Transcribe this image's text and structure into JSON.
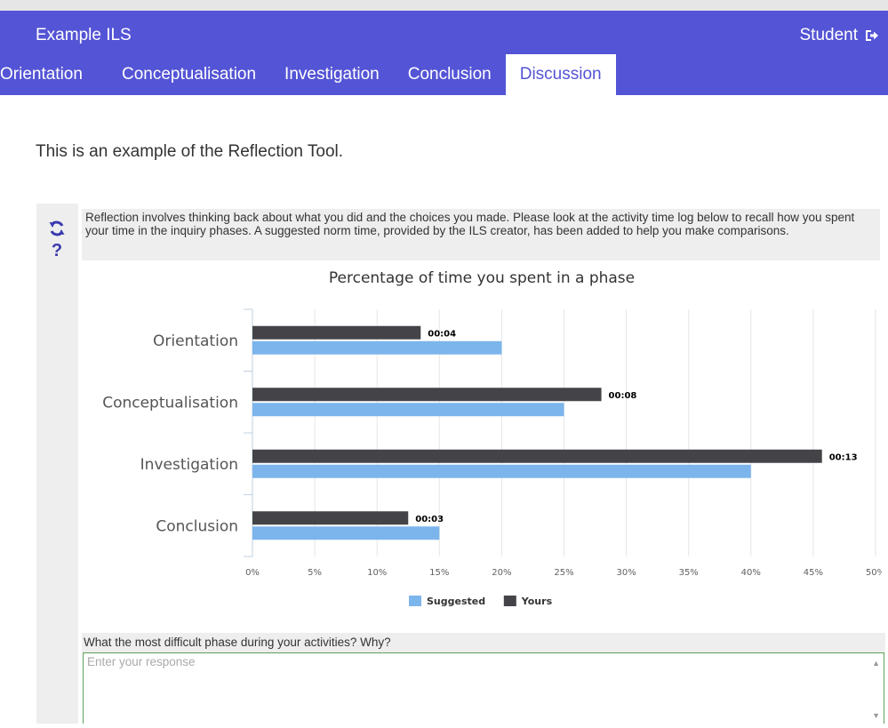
{
  "header": {
    "app_title": "Example ILS",
    "user_label": "Student",
    "user_icon": "sign-out-icon",
    "background": "#5454d6"
  },
  "tabs": [
    {
      "label": "Orientation",
      "active": false
    },
    {
      "label": "Conceptualisation",
      "active": false
    },
    {
      "label": "Investigation",
      "active": false
    },
    {
      "label": "Conclusion",
      "active": false
    },
    {
      "label": "Discussion",
      "active": true
    }
  ],
  "intro_text": "This is an example of the Reflection Tool.",
  "side_icons": [
    "refresh-icon",
    "help-icon"
  ],
  "description": "Reflection involves thinking back about what you did and the choices you made. Please look at the activity time log below to recall how you spent your time in the inquiry phases. A suggested norm time, provided by the ILS creator, has been added to help you make comparisons.",
  "chart_data": {
    "type": "bar",
    "orientation": "horizontal",
    "title": "Percentage of time you spent in a phase",
    "categories": [
      "Orientation",
      "Conceptualisation",
      "Investigation",
      "Conclusion"
    ],
    "series": [
      {
        "name": "Yours",
        "color": "#434348",
        "values": [
          13.5,
          28,
          45.7,
          12.5
        ],
        "labels": [
          "00:04",
          "00:08",
          "00:13",
          "00:03"
        ]
      },
      {
        "name": "Suggested",
        "color": "#7cb5ec",
        "values": [
          20,
          25,
          40,
          15
        ]
      }
    ],
    "xlim": [
      0,
      50
    ],
    "x_ticks": [
      "0%",
      "5%",
      "10%",
      "15%",
      "20%",
      "25%",
      "30%",
      "35%",
      "40%",
      "45%",
      "50%"
    ],
    "grid": true,
    "legend": [
      "Suggested",
      "Yours"
    ],
    "legend_position": "bottom-center"
  },
  "question": {
    "text": "What the most difficult phase during your activities? Why?",
    "placeholder": "Enter your response"
  }
}
